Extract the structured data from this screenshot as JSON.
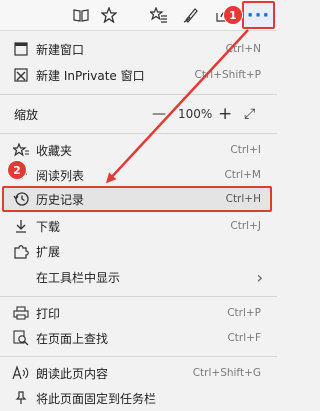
{
  "toolbar": {
    "icons": [
      "book-icon",
      "star-icon",
      "favorites-icon",
      "pen-icon",
      "share-icon"
    ],
    "more_label": "···",
    "badge1": "1"
  },
  "menu": {
    "new_window": {
      "label": "新建窗口",
      "shortcut": "Ctrl+N"
    },
    "new_private": {
      "label": "新建 InPrivate 窗口",
      "shortcut": "Ctrl+Shift+P"
    },
    "zoom": {
      "label": "缩放",
      "minus": "—",
      "value": "100%",
      "plus": "+",
      "fullscreen": "⤢"
    },
    "favorites": {
      "label": "收藏夹",
      "shortcut": "Ctrl+I"
    },
    "reading_list": {
      "label": "阅读列表",
      "shortcut": "Ctrl+M"
    },
    "history": {
      "label": "历史记录",
      "shortcut": "Ctrl+H",
      "badge": "2"
    },
    "downloads": {
      "label": "下载",
      "shortcut": "Ctrl+J"
    },
    "extensions": {
      "label": "扩展"
    },
    "show_in_toolbar": {
      "label": "在工具栏中显示",
      "chevron": "›"
    },
    "print": {
      "label": "打印",
      "shortcut": "Ctrl+P"
    },
    "find": {
      "label": "在页面上查找",
      "shortcut": "Ctrl+F"
    },
    "read_aloud": {
      "label": "朗读此页内容",
      "shortcut": "Ctrl+Shift+G"
    },
    "pin": {
      "label": "将此页面固定到任务栏"
    }
  }
}
